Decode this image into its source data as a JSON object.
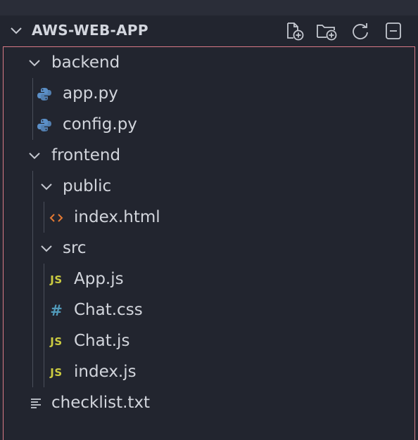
{
  "explorer": {
    "title": "AWS-WEB-APP",
    "actions": {
      "new_file": "new-file-icon",
      "new_folder": "new-folder-icon",
      "refresh": "refresh-icon",
      "collapse_all": "collapse-all-icon"
    }
  },
  "tree": {
    "backend": {
      "label": "backend",
      "children": [
        {
          "label": "app.py",
          "icon": "python-icon"
        },
        {
          "label": "config.py",
          "icon": "python-icon"
        }
      ]
    },
    "frontend": {
      "label": "frontend",
      "public": {
        "label": "public",
        "children": [
          {
            "label": "index.html",
            "icon": "html-icon"
          }
        ]
      },
      "src": {
        "label": "src",
        "children": [
          {
            "label": "App.js",
            "icon": "js-icon"
          },
          {
            "label": "Chat.css",
            "icon": "css-icon"
          },
          {
            "label": "Chat.js",
            "icon": "js-icon"
          },
          {
            "label": "index.js",
            "icon": "js-icon"
          }
        ]
      }
    },
    "root_files": [
      {
        "label": "checklist.txt",
        "icon": "text-file-icon"
      }
    ]
  },
  "icon_glyphs": {
    "js": "JS",
    "css": "#"
  },
  "colors": {
    "background": "#22252f",
    "focus_border": "#d97a86",
    "text": "#d2d5dc",
    "js": "#cbcb41",
    "css": "#519aba",
    "html": "#e37933",
    "python": "#5b8fc7"
  }
}
